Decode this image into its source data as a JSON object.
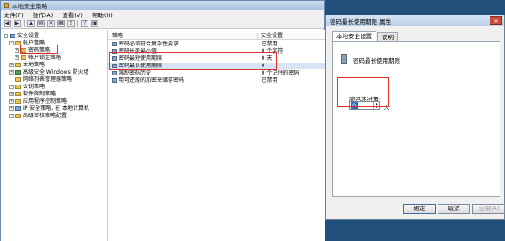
{
  "window": {
    "title": "本地安全策略"
  },
  "menu": [
    "文件(F)",
    "操作(A)",
    "查看(V)",
    "帮助(H)"
  ],
  "toolbar": {
    "icons": [
      "back-icon",
      "forward-icon",
      "up-icon",
      "show-tree-icon",
      "delete-icon",
      "properties-icon",
      "export-icon",
      "help-icon",
      "console-icon"
    ]
  },
  "tree": {
    "items": [
      {
        "label": "安全设置",
        "expander": "-"
      },
      {
        "label": "帐户策略",
        "expander": "-"
      },
      {
        "label": "密码策略",
        "expander": "+"
      },
      {
        "label": "帐户锁定策略",
        "expander": "+"
      },
      {
        "label": "本地策略",
        "expander": "+"
      },
      {
        "label": "高级安全 Windows 防火墙",
        "expander": "+"
      },
      {
        "label": "网络列表管理器策略",
        "expander": ""
      },
      {
        "label": "公钥策略",
        "expander": "+"
      },
      {
        "label": "软件限制策略",
        "expander": "+"
      },
      {
        "label": "应用程序控制策略",
        "expander": "+"
      },
      {
        "label": "IP 安全策略, 在 本地计算机",
        "expander": "+"
      },
      {
        "label": "高级审核策略配置",
        "expander": "+"
      }
    ]
  },
  "list": {
    "columns": [
      "策略",
      "安全设置"
    ],
    "rows": [
      {
        "policy": "密码必须符合复杂性要求",
        "setting": "已禁用"
      },
      {
        "policy": "密码长度最小值",
        "setting": "0 个字符"
      },
      {
        "policy": "密码最短使用期限",
        "setting": "0 天"
      },
      {
        "policy": "密码最长使用期限",
        "setting": "0"
      },
      {
        "policy": "强制密码历史",
        "setting": "0 个记住的密码"
      },
      {
        "policy": "用可还原的加密来储存密码",
        "setting": "已禁用"
      }
    ]
  },
  "dialog": {
    "title": "密码最长使用期限 属性",
    "close_label": "✕",
    "tabs": [
      "本地安全设置",
      "说明"
    ],
    "policy_name": "密码最长使用期限",
    "expire_label": "密码不过期:",
    "expire_value": "0",
    "unit": "天",
    "buttons": {
      "ok": "确定",
      "cancel": "取消",
      "apply": "应用(A)"
    }
  }
}
